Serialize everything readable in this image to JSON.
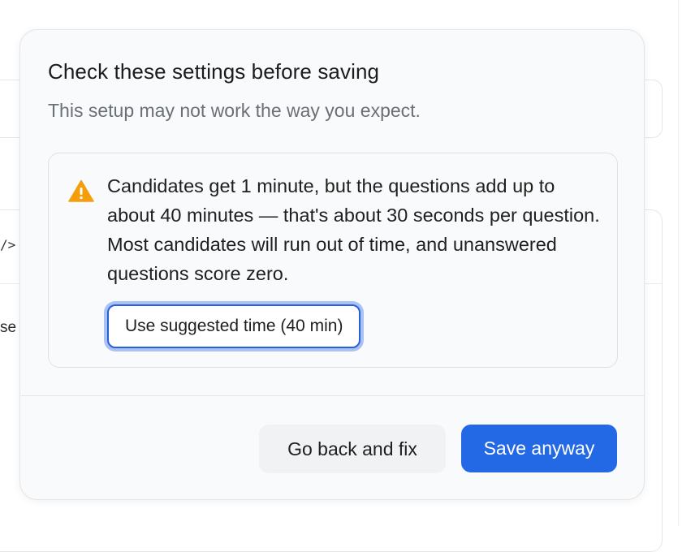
{
  "background": {
    "code_glyph": "/>",
    "text_fragment": "se"
  },
  "dialog": {
    "title": "Check these settings before saving",
    "subtitle": "This setup may not work the way you expect.",
    "warning": {
      "icon": "warning-triangle-icon",
      "icon_color": "#f59e0b",
      "message": "Candidates get 1 minute, but the questions add up to about 40 minutes — that's about 30 seconds per question. Most candidates will run out of time, and unanswered questions score zero.",
      "action_label": "Use suggested time (40 min)"
    },
    "footer": {
      "back_label": "Go back and fix",
      "save_label": "Save anyway"
    }
  },
  "colors": {
    "primary": "#2369e6",
    "warning": "#f59e0b",
    "focus_ring": "#a9c2f5"
  }
}
